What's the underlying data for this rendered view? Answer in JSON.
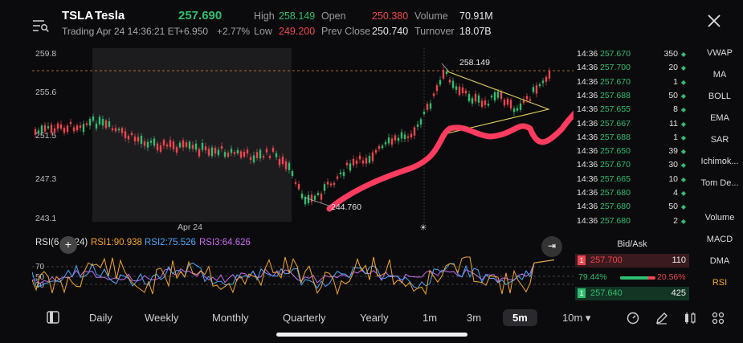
{
  "header": {
    "symbol": "TSLA",
    "name": "Tesla",
    "price": "257.690",
    "status": "Trading Apr 24 14:36:21 ET",
    "change": "+6.950",
    "change_pct": "+2.77%",
    "high_label": "High",
    "high": "258.149",
    "low_label": "Low",
    "low": "249.200",
    "open_label": "Open",
    "open": "250.380",
    "prev_close_label": "Prev Close",
    "prev_close": "250.740",
    "volume_label": "Volume",
    "volume": "70.91M",
    "turnover_label": "Turnover",
    "turnover": "18.07B"
  },
  "chart": {
    "y_ticks": [
      "259.8",
      "255.6",
      "251.5",
      "247.3",
      "243.1"
    ],
    "x_label": "Apr 24",
    "high_marker": "258.149",
    "low_marker": "244.760",
    "colors": {
      "up": "#2fbf71",
      "down": "#f0454f",
      "annotation": "#ff3b5f",
      "triangle": "#e8d85a"
    }
  },
  "rsi": {
    "label": "RSI(6,12,24)",
    "rsi1": "RSI1:90.938",
    "rsi2": "RSI2:75.526",
    "rsi3": "RSI3:64.626",
    "levels": [
      "70",
      "50",
      "30"
    ],
    "colors": {
      "rsi1": "#f5a623",
      "rsi2": "#4aa8ff",
      "rsi3": "#c86bf0"
    }
  },
  "trades": [
    {
      "time": "14:36",
      "price": "257.670",
      "qty": "350",
      "dir": "up"
    },
    {
      "time": "14:36",
      "price": "257.700",
      "qty": "20",
      "dir": "up"
    },
    {
      "time": "14:36",
      "price": "257.670",
      "qty": "1",
      "dir": "up"
    },
    {
      "time": "14:36",
      "price": "257.688",
      "qty": "50",
      "dir": "up"
    },
    {
      "time": "14:36",
      "price": "257.655",
      "qty": "8",
      "dir": "up"
    },
    {
      "time": "14:36",
      "price": "257.667",
      "qty": "11",
      "dir": "up"
    },
    {
      "time": "14:36",
      "price": "257.688",
      "qty": "1",
      "dir": "up"
    },
    {
      "time": "14:36",
      "price": "257.650",
      "qty": "39",
      "dir": "up"
    },
    {
      "time": "14:36",
      "price": "257.670",
      "qty": "30",
      "dir": "up"
    },
    {
      "time": "14:36",
      "price": "257.665",
      "qty": "10",
      "dir": "up"
    },
    {
      "time": "14:36",
      "price": "257.680",
      "qty": "4",
      "dir": "up"
    },
    {
      "time": "14:36",
      "price": "257.680",
      "qty": "50",
      "dir": "up"
    },
    {
      "time": "14:36",
      "price": "257.680",
      "qty": "2",
      "dir": "up"
    }
  ],
  "bidask": {
    "title": "Bid/Ask",
    "ask_level": "1",
    "ask_price": "257.700",
    "ask_qty": "110",
    "bid_pct": "79.44%",
    "ask_pct": "20.56%",
    "bid_level": "1",
    "bid_price": "257.640",
    "bid_qty": "425"
  },
  "indicators_main": [
    "VWAP",
    "MA",
    "BOLL",
    "EMA",
    "SAR",
    "Ichimok...",
    "Tom De..."
  ],
  "indicators_sub": [
    "Volume",
    "MACD",
    "DMA",
    "RSI"
  ],
  "active_sub_indicator": "RSI",
  "timeframes": [
    "Daily",
    "Weekly",
    "Monthly",
    "Quarterly",
    "Yearly",
    "1m",
    "3m",
    "5m",
    "10m ▾"
  ],
  "active_timeframe": "5m"
}
